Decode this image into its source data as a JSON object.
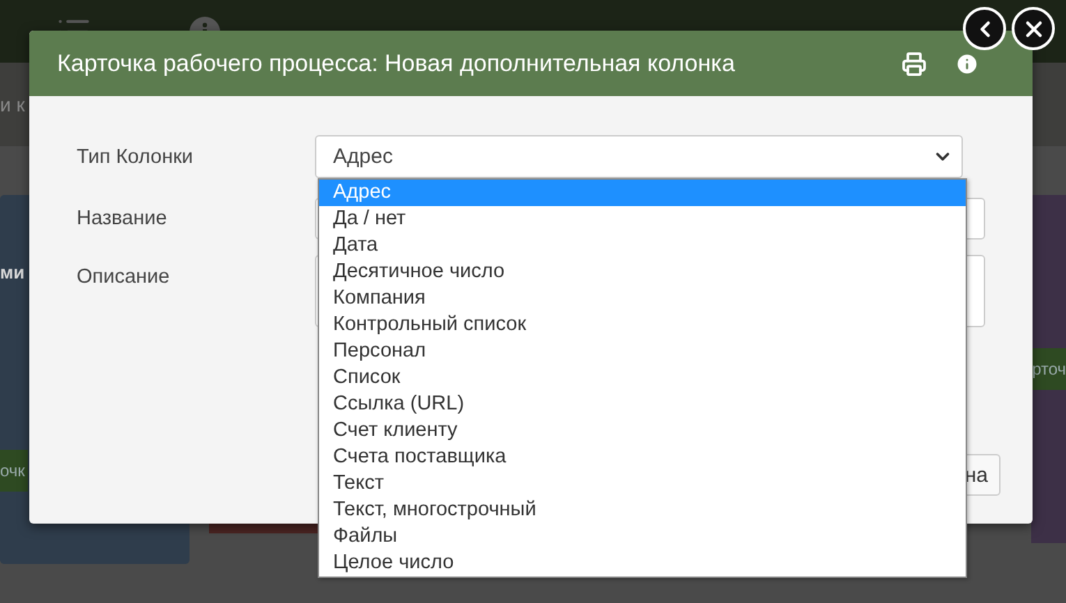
{
  "background": {
    "header_text": "и к",
    "card_text": "ми",
    "left_button": "очк",
    "right_button": "рточ"
  },
  "nav": {
    "buttons": [
      {
        "kind": "back"
      },
      {
        "kind": "close"
      }
    ]
  },
  "modal": {
    "title": "Карточка рабочего процесса: Новая дополнительная колонка",
    "fields": [
      {
        "label": "Тип Колонки",
        "kind": "select",
        "value": "Адрес"
      },
      {
        "label": "Название",
        "kind": "input"
      },
      {
        "label": "Описание",
        "kind": "textarea"
      }
    ],
    "dropdown": {
      "options": [
        {
          "label": "Адрес",
          "selected": true
        },
        {
          "label": "Да / нет",
          "selected": false
        },
        {
          "label": "Дата",
          "selected": false
        },
        {
          "label": "Десятичное число",
          "selected": false
        },
        {
          "label": "Компания",
          "selected": false
        },
        {
          "label": "Контрольный список",
          "selected": false
        },
        {
          "label": "Персонал",
          "selected": false
        },
        {
          "label": "Список",
          "selected": false
        },
        {
          "label": "Ссылка (URL)",
          "selected": false
        },
        {
          "label": "Счет клиенту",
          "selected": false
        },
        {
          "label": "Счета поставщика",
          "selected": false
        },
        {
          "label": "Текст",
          "selected": false
        },
        {
          "label": "Текст, многострочный",
          "selected": false
        },
        {
          "label": "Файлы",
          "selected": false
        },
        {
          "label": "Целое число",
          "selected": false
        }
      ]
    },
    "button": "на"
  }
}
